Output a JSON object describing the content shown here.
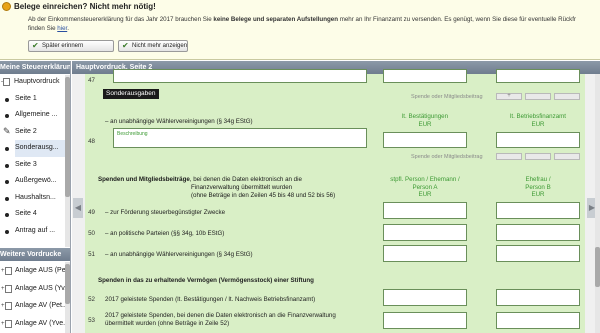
{
  "notice": {
    "title": "Belege einreichen? Nicht mehr nötig!",
    "line1_pre": "Ab der Einkommensteuererklärung für das Jahr 2017 brauchen Sie ",
    "line1_bold": "keine Belege und separaten Aufstellungen",
    "line1_post": " mehr an Ihr Finanzamt zu versenden. Es genügt, wenn Sie diese für eventuelle Rückfr",
    "line2_pre": "finden Sie ",
    "line2_link": "hier",
    "line2_post": ".",
    "remind_label": "Später erinnern",
    "never_label": "Nicht mehr anzeigen"
  },
  "sidebar": {
    "header": "Meine Steuererklärung",
    "items": [
      {
        "label": "Hauptvordruck",
        "kind": "doc"
      },
      {
        "label": "Seite 1",
        "kind": "bullet"
      },
      {
        "label": "Allgemeine ...",
        "kind": "bullet"
      },
      {
        "label": "Seite 2",
        "kind": "pen"
      },
      {
        "label": "Sonderausg...",
        "kind": "bullet"
      },
      {
        "label": "Seite 3",
        "kind": "bullet"
      },
      {
        "label": "Außergewö...",
        "kind": "bullet"
      },
      {
        "label": "Haushaltsn...",
        "kind": "bullet"
      },
      {
        "label": "Seite 4",
        "kind": "bullet"
      },
      {
        "label": "Antrag auf ...",
        "kind": "bullet"
      }
    ],
    "header2": "Weitere Vordrucke",
    "annexes": [
      "Anlage AUS (Pe...",
      "Anlage AUS (Yv...",
      "Anlage AV (Pet...",
      "Anlage AV (Yve..."
    ]
  },
  "main": {
    "header": "Hauptvordruck, Seite 2",
    "tooltip": "Sonderausgaben",
    "row47": "47",
    "spende1": "Spende oder Mitgliedsbeitrag",
    "spende2": "Spende oder Mitgliedsbeitrag",
    "plus": "+",
    "waehler1": "– an unabhängige Wählervereinigungen (§ 34g EStG)",
    "lt_best": "lt. Bestätigungen",
    "lt_betrieb": "lt. Betriebsfinanzamt",
    "eur": "EUR",
    "beschreibung": "Beschreibung",
    "row48": "48",
    "spenden_title": "Spenden und Mitgliedsbeiträge",
    "spenden_rest": ", bei denen die Daten elektronisch an die",
    "spenden_l2": "Finanzverwaltung übermittelt wurden",
    "spenden_l3": "(ohne Beträge in den Zeilen 45 bis 48 und 52 bis 56)",
    "col_a_l1": "stpfl. Person / Ehemann /",
    "col_a_l2": "Person A",
    "col_b_l1": "Ehefrau /",
    "col_b_l2": "Person B",
    "row49": "49",
    "r49": "– zur Förderung steuerbegünstigter Zwecke",
    "row50": "50",
    "r50": "– an politische Parteien (§§ 34g, 10b EStG)",
    "row51": "51",
    "r51": "– an unabhängige Wählervereinigungen (§ 34g EStG)",
    "vermoegen_title": "Spenden in das zu erhaltende Vermögen (Vermögensstock) einer Stiftung",
    "row52": "52",
    "r52": "2017 geleistete Spenden (lt. Bestätigungen / lt. Nachweis Betriebsfinanzamt)",
    "row53": "53",
    "r53_l1": "2017 geleistete Spenden, bei denen die Daten elektronisch an die Finanzverwaltung",
    "r53_l2": "übermittelt wurden (ohne Beträge in Zeile 52)"
  }
}
